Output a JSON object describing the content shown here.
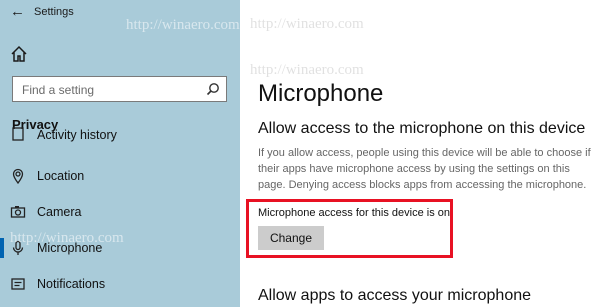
{
  "window": {
    "title": "Settings"
  },
  "sidebar": {
    "search_placeholder": "Find a setting",
    "section": "Privacy",
    "items": [
      {
        "label": "Activity history",
        "icon": "activity-history-icon"
      },
      {
        "label": "Location",
        "icon": "location-icon"
      },
      {
        "label": "Camera",
        "icon": "camera-icon"
      },
      {
        "label": "Microphone",
        "icon": "microphone-icon",
        "selected": true
      },
      {
        "label": "Notifications",
        "icon": "notifications-icon"
      }
    ]
  },
  "main": {
    "title": "Microphone",
    "heading": "Allow access to the microphone on this device",
    "description": "If you allow access, people using this device will be able to choose if their apps have microphone access by using the settings on this page. Denying access blocks apps from accessing the microphone.",
    "status": "Microphone access for this device is on",
    "change_label": "Change",
    "heading2": "Allow apps to access your microphone"
  },
  "watermark": "http://winaero.com",
  "colors": {
    "sidebar_bg": "#a9cbd9",
    "accent": "#0063b1",
    "highlight": "#e81123",
    "button_bg": "#cccccc"
  }
}
